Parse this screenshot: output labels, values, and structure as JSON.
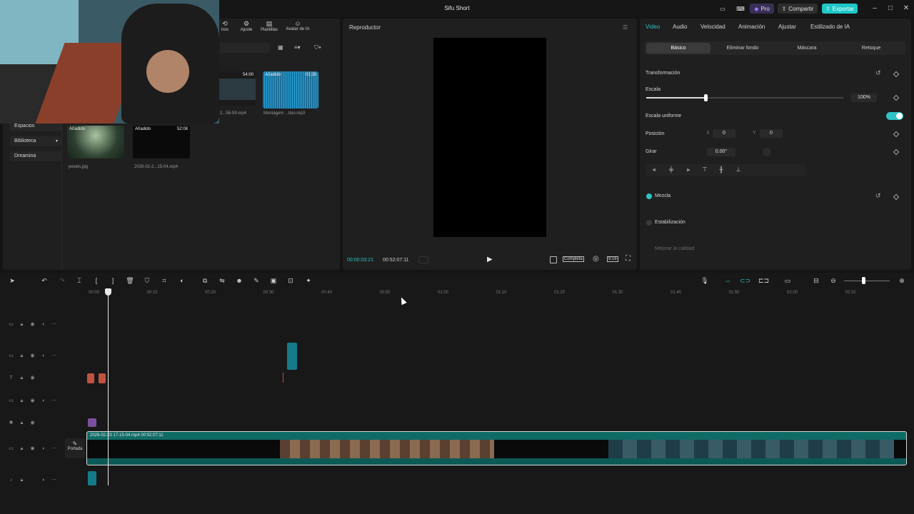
{
  "app": {
    "title": "Sifu Short",
    "pro_label": "Pro",
    "share_label": "Compartir",
    "export_label": "Exportar"
  },
  "media": {
    "toolbar": {
      "icons": [
        "tros",
        "Ajuste",
        "Plantillas",
        "Avatar de IA"
      ]
    },
    "sidebar": [
      {
        "label": "Espacios"
      },
      {
        "label": "Biblioteca"
      },
      {
        "label": "Dreamina"
      }
    ],
    "items": [
      {
        "badge": "",
        "duration": "54:00",
        "name": "2...56-59.mp4"
      },
      {
        "badge": "Añadido",
        "duration": "01:28",
        "name": "Montagem ...lton.mp3"
      },
      {
        "badge": "Añadido",
        "duration": "",
        "name": "pexels.jpg"
      },
      {
        "badge": "Añadido",
        "duration": "52:08",
        "name": "2026-02-2...15-04.mp4"
      }
    ]
  },
  "player": {
    "title": "Reproductor",
    "time_current": "00:00:03:21",
    "time_total": "00:52:07:11",
    "full_label": "Completa",
    "ratio_label": "9:16"
  },
  "props": {
    "tabs": [
      "Video",
      "Audio",
      "Velocidad",
      "Animación",
      "Ajustar",
      "Estilizado de IA"
    ],
    "subtabs": [
      "Básico",
      "Eliminar fondo",
      "Máscara",
      "Retoque"
    ],
    "transform_label": "Transformación",
    "scale_label": "Escala",
    "scale_value": "100%",
    "scale_level": 0.3,
    "uniform_label": "Escala uniforme",
    "position_label": "Posición",
    "pos_x_label": "X",
    "pos_x": "0",
    "pos_y_label": "Y",
    "pos_y": "0",
    "rotate_label": "Girar",
    "rotate_value": "0.00°",
    "blend_label": "Mezcla",
    "stabilize_label": "Estabilización",
    "enhance_label": "Mejorar la calidad",
    "accent": "#2fc3c3"
  },
  "timeline": {
    "ruler": [
      "00:00",
      "00:10",
      "00:20",
      "00:30",
      "00:40",
      "00:50",
      "01:00",
      "01:10",
      "01:20",
      "01:30",
      "01:40",
      "01:50",
      "02:00",
      "02:10"
    ],
    "main_clip_label": "2026-02-23 17-15-04.mp4   00:52:07:11",
    "cover_label": "Portada"
  }
}
